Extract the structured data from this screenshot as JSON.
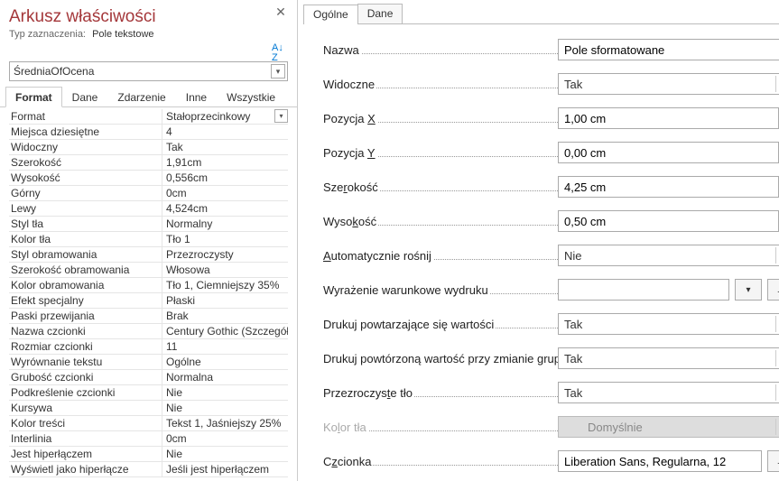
{
  "left": {
    "title": "Arkusz właściwości",
    "subtitle_label": "Typ zaznaczenia:",
    "subtitle_value": "Pole tekstowe",
    "object": "ŚredniaOfOcena",
    "tabs": [
      "Format",
      "Dane",
      "Zdarzenie",
      "Inne",
      "Wszystkie"
    ],
    "active_tab": 0,
    "rows": [
      {
        "label": "Format",
        "value": "Stałoprzecinkowy",
        "dd": true
      },
      {
        "label": "Miejsca dziesiętne",
        "value": "4"
      },
      {
        "label": "Widoczny",
        "value": "Tak"
      },
      {
        "label": "Szerokość",
        "value": "1,91cm"
      },
      {
        "label": "Wysokość",
        "value": "0,556cm"
      },
      {
        "label": "Górny",
        "value": "0cm"
      },
      {
        "label": "Lewy",
        "value": "4,524cm"
      },
      {
        "label": "Styl tła",
        "value": "Normalny"
      },
      {
        "label": "Kolor tła",
        "value": "Tło 1"
      },
      {
        "label": "Styl obramowania",
        "value": "Przezroczysty"
      },
      {
        "label": "Szerokość obramowania",
        "value": "Włosowa"
      },
      {
        "label": "Kolor obramowania",
        "value": "Tło 1, Ciemniejszy 35%"
      },
      {
        "label": "Efekt specjalny",
        "value": "Płaski"
      },
      {
        "label": "Paski przewijania",
        "value": "Brak"
      },
      {
        "label": "Nazwa czcionki",
        "value": "Century Gothic (Szczegół)"
      },
      {
        "label": "Rozmiar czcionki",
        "value": "11"
      },
      {
        "label": "Wyrównanie tekstu",
        "value": "Ogólne"
      },
      {
        "label": "Grubość czcionki",
        "value": "Normalna"
      },
      {
        "label": "Podkreślenie czcionki",
        "value": "Nie"
      },
      {
        "label": "Kursywa",
        "value": "Nie"
      },
      {
        "label": "Kolor treści",
        "value": "Tekst 1, Jaśniejszy 25%"
      },
      {
        "label": "Interlinia",
        "value": "0cm"
      },
      {
        "label": "Jest hiperłączem",
        "value": "Nie"
      },
      {
        "label": "Wyświetl jako hiperłącze",
        "value": "Jeśli jest hiperłączem"
      }
    ]
  },
  "right": {
    "tabs": [
      "Ogólne",
      "Dane"
    ],
    "active_tab": 0,
    "fields": {
      "name_label": "Nazwa",
      "name_value": "Pole sformatowane",
      "visible_label": "Widoczne",
      "visible_value": "Tak",
      "posx_pre": "Pozycja ",
      "posx_u": "X",
      "posx_value": "1,00 cm",
      "posy_pre": "Pozycja ",
      "posy_u": "Y",
      "posy_value": "0,00 cm",
      "width_pre": "Sze",
      "width_u": "r",
      "width_post": "okość",
      "width_value": "4,25 cm",
      "height_pre": "Wyso",
      "height_u": "k",
      "height_post": "ość",
      "height_value": "0,50 cm",
      "autog_u": "A",
      "autog_post": "utomatycznie rośnij",
      "autog_value": "Nie",
      "cond_label": "Wyrażenie warunkowe wydruku",
      "cond_value": "",
      "repeat_label": "Drukuj powtarzające się wartości",
      "repeat_value": "Tak",
      "repeatg_label": "Drukuj powtórzoną wartość przy zmianie grupy",
      "repeatg_value": "Tak",
      "transbg_pre": "Przezroczys",
      "transbg_u": "t",
      "transbg_post": "e tło",
      "transbg_value": "Tak",
      "bgcolor_pre": "Ko",
      "bgcolor_u": "l",
      "bgcolor_post": "or tła",
      "bgcolor_value": "Domyślnie",
      "font_pre": "C",
      "font_u": "z",
      "font_post": "cionka",
      "font_value": "Liberation Sans, Regularna, 12"
    }
  }
}
